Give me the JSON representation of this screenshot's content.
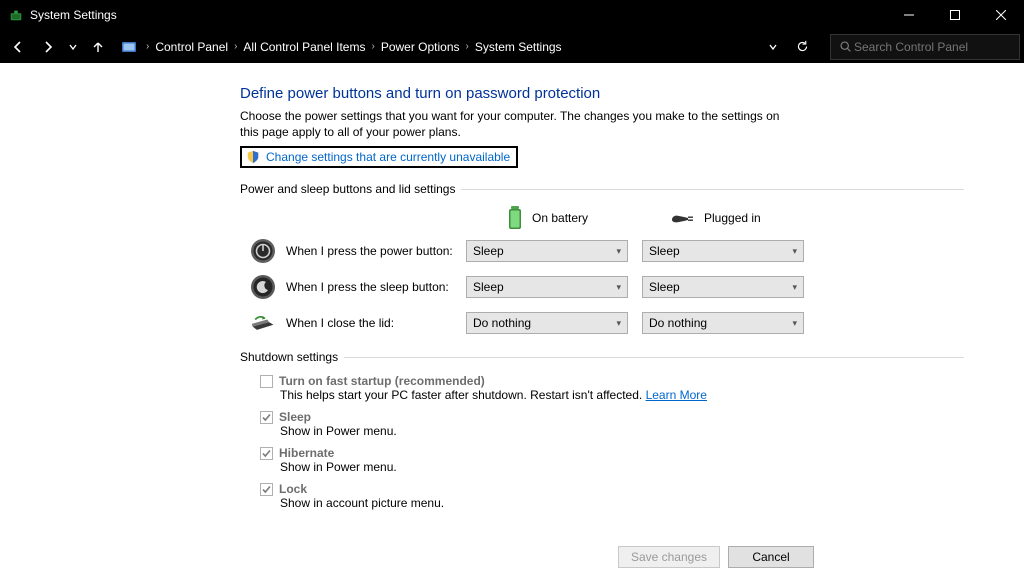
{
  "window": {
    "title": "System Settings"
  },
  "breadcrumb": {
    "items": [
      "Control Panel",
      "All Control Panel Items",
      "Power Options",
      "System Settings"
    ]
  },
  "search": {
    "placeholder": "Search Control Panel"
  },
  "page": {
    "title": "Define power buttons and turn on password protection",
    "description": "Choose the power settings that you want for your computer. The changes you make to the settings on this page apply to all of your power plans.",
    "admin_link": "Change settings that are currently unavailable"
  },
  "power_group": {
    "title": "Power and sleep buttons and lid settings",
    "col_battery": "On battery",
    "col_plugged": "Plugged in",
    "rows": [
      {
        "label": "When I press the power button:",
        "battery": "Sleep",
        "plugged": "Sleep"
      },
      {
        "label": "When I press the sleep button:",
        "battery": "Sleep",
        "plugged": "Sleep"
      },
      {
        "label": "When I close the lid:",
        "battery": "Do nothing",
        "plugged": "Do nothing"
      }
    ]
  },
  "shutdown_group": {
    "title": "Shutdown settings",
    "items": [
      {
        "label": "Turn on fast startup (recommended)",
        "sub": "This helps start your PC faster after shutdown. Restart isn't affected.",
        "learn": "Learn More",
        "checked": false
      },
      {
        "label": "Sleep",
        "sub": "Show in Power menu.",
        "checked": true
      },
      {
        "label": "Hibernate",
        "sub": "Show in Power menu.",
        "checked": true
      },
      {
        "label": "Lock",
        "sub": "Show in account picture menu.",
        "checked": true
      }
    ]
  },
  "footer": {
    "save": "Save changes",
    "cancel": "Cancel"
  }
}
